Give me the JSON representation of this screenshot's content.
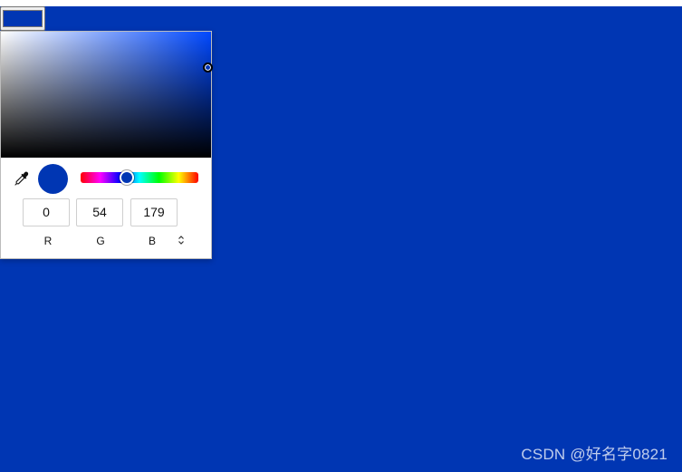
{
  "page": {
    "background_color": "#0036b3"
  },
  "color_input": {
    "value": "#0036b3"
  },
  "picker": {
    "saturation_area": {
      "hue_color": "#0048ff"
    },
    "eyedropper_icon": "eyedropper-icon",
    "preview_color": "#0036b3",
    "hue_slider": {
      "value_fraction": 0.38
    },
    "rgb": {
      "r": "0",
      "g": "54",
      "b": "179"
    },
    "labels": {
      "r": "R",
      "g": "G",
      "b": "B"
    },
    "mode_toggle_icon": "updown-arrows-icon",
    "mode_toggle_glyph": "⌃⌄"
  },
  "watermark": {
    "text": "CSDN @好名字0821"
  }
}
